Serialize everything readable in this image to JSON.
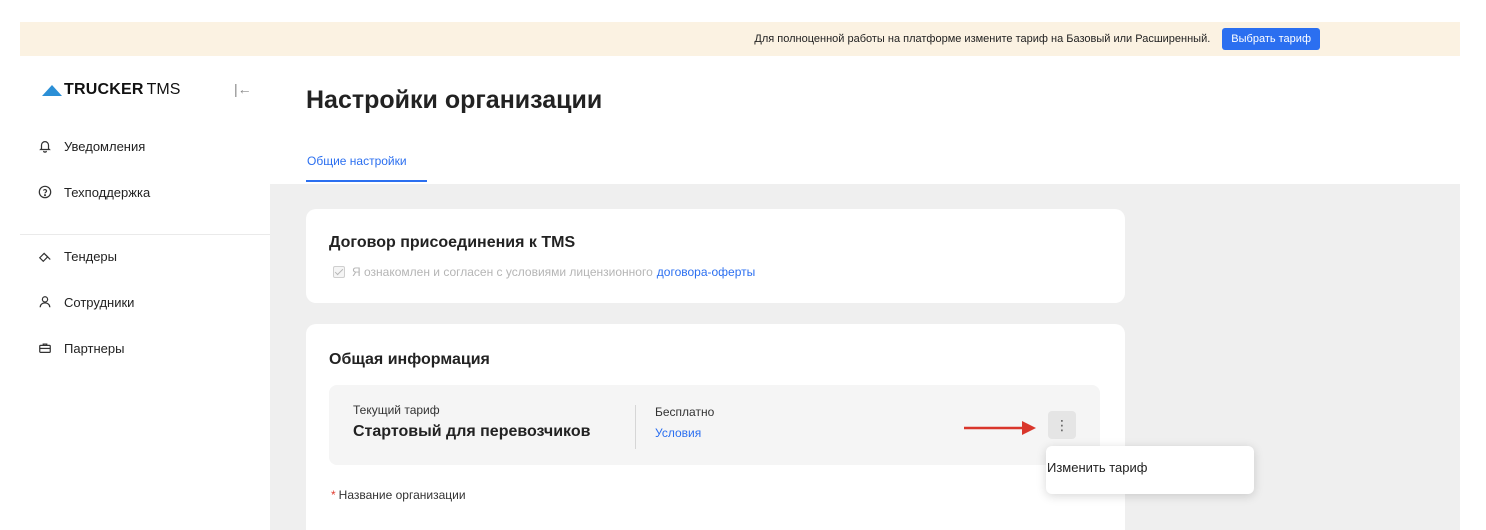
{
  "banner": {
    "text": "Для полноценной работы на платформе измените тариф на Базовый или Расширенный.",
    "button_label": "Выбрать тариф"
  },
  "sidebar": {
    "logo_main": "TRUCKER",
    "logo_sub": "TMS",
    "items": [
      {
        "label": "Уведомления",
        "icon": "bell-icon"
      },
      {
        "label": "Техподдержка",
        "icon": "help-circle-icon"
      },
      {
        "label": "Тендеры",
        "icon": "gavel-icon"
      },
      {
        "label": "Сотрудники",
        "icon": "user-icon"
      },
      {
        "label": "Партнеры",
        "icon": "briefcase-icon"
      }
    ]
  },
  "header": {
    "title": "Настройки организации",
    "tabs": [
      {
        "label": "Общие настройки",
        "active": true
      }
    ]
  },
  "agreement": {
    "title": "Договор присоединения к TMS",
    "checkbox_text": "Я ознакомлен и согласен с условиями лицензионного",
    "link_text": "договора-оферты",
    "checked": true
  },
  "general": {
    "title": "Общая информация",
    "tariff_label": "Текущий тариф",
    "tariff_value": "Стартовый для перевозчиков",
    "price": "Бесплатно",
    "terms_link": "Условия",
    "org_name_label": "Название организации",
    "required_mark": "*"
  },
  "menu": {
    "items": [
      {
        "label": "Изменить тариф"
      }
    ]
  },
  "colors": {
    "accent": "#2b6ff0",
    "banner_bg": "#fbf2e2",
    "arrow": "#d9362b",
    "logo": "#2b8fd6"
  }
}
